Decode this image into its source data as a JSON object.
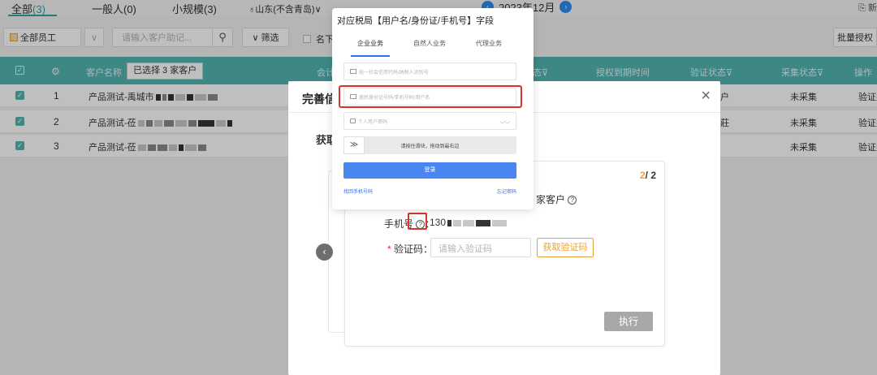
{
  "tabs": {
    "all_label": "全部",
    "all_count": "(3)",
    "general": "一般人(0)",
    "small": "小规模(3)",
    "region": "♁山东(不含青岛)∨",
    "month": "2023年12月",
    "prev_month_icon": "‹",
    "next_month_icon": "›",
    "new_label": "⎘ 新"
  },
  "toolbar": {
    "staff_label": "全部员工",
    "dropdown_icon": "∨",
    "search_placeholder": "请输入客户助记...",
    "search_icon": "⚲",
    "filter_label": "∨ 筛选",
    "name_prefix": "名下",
    "batch_auth": "批量授权"
  },
  "table": {
    "header_check": "✓",
    "header_settings": "⚙",
    "headers": [
      "客户名称",
      "会计",
      "态",
      "授权到期时间",
      "验证状态",
      "采集状态",
      "操作"
    ],
    "filter_glyph": "⊽",
    "selection_tooltip": "已选择 3 家客户",
    "rows": [
      {
        "idx": "1",
        "name": "产品测试-禹城市",
        "frag": "户",
        "status": "未采集",
        "op": "验证账"
      },
      {
        "idx": "2",
        "name": "产品测试-莅",
        "frag": "莊",
        "status": "未采集",
        "op": "验证账"
      },
      {
        "idx": "3",
        "name": "产品测试-莅",
        "frag": "",
        "status": "未采集",
        "op": "验证账"
      }
    ],
    "check_glyph": "✓"
  },
  "modal": {
    "title": "完善信",
    "close_icon": "×",
    "subtitle": "获取",
    "pager_current": "2",
    "pager_total": "/ 2",
    "head_text_pre": "",
    "head_count": "2",
    "head_text_post": "家客户",
    "help_icon": "?",
    "phone_label": "手机号",
    "phone_help_icon": "?",
    "phone_colon": "：",
    "phone_value": "130",
    "code_required": "*",
    "code_label": "验证码：",
    "code_placeholder": "请输入验证码",
    "get_code_label": "获取验证码",
    "exec_label": "执行",
    "prev_icon": "‹"
  },
  "popup": {
    "title": "对应税局【用户名/身份证/手机号】字段",
    "tabs": [
      "企业业务",
      "自然人业务",
      "代理业务"
    ],
    "field_tax_id": "统一社会信用代码/纳税人识别号",
    "field_user": "居民身份证号码/手机号码/用户名",
    "field_password": "个人用户密码",
    "eye_icon": "◡◡",
    "slider_text": "请按住滑块，拖动到最右边",
    "slider_icon": "≫",
    "login_label": "登录",
    "link_left": "找回手机号码",
    "link_right": "忘记密码"
  },
  "colors": {
    "teal": "#52b4b1",
    "orange": "#e6a23c",
    "red_highlight": "#d9342b",
    "blue": "#4a86f0"
  }
}
